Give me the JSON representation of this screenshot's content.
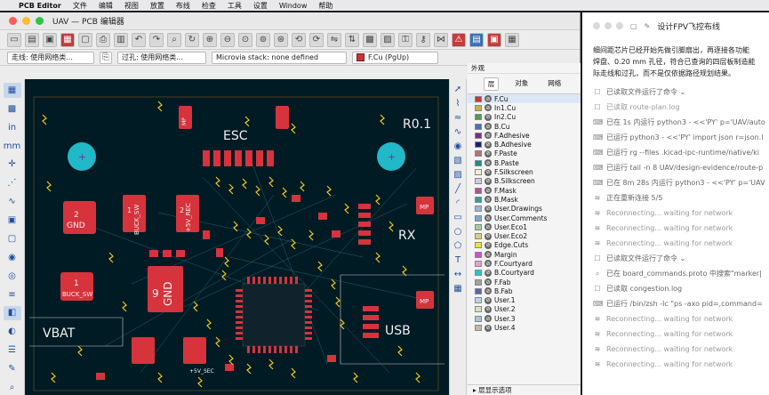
{
  "menubar": {
    "app": "PCB Editor",
    "items": [
      "文件",
      "编辑",
      "视图",
      "放置",
      "布线",
      "检查",
      "工具",
      "设置",
      "Window",
      "帮助"
    ]
  },
  "window": {
    "title": "UAV — PCB 编辑器"
  },
  "subbar": {
    "track": "走线: 使用网络类...",
    "via": "过孔: 使用网络类...",
    "microvia": "Microvia stack: none defined",
    "layer": "F.Cu (PgUp)"
  },
  "board": {
    "labels": {
      "esc": "ESC",
      "rev": "R0.1",
      "rx": "RX",
      "usb": "USB",
      "vbat": "VBAT",
      "gnd": "GND",
      "buck_sw": "BUCK_SW",
      "buck_sw2": "BUCK_SW",
      "v5_rec": "+5V_REC",
      "v5_sec": "+5V_SEC",
      "gnd2": "GND",
      "mp": "MP",
      "n2": "2",
      "n1": "1",
      "n2b": "2",
      "n1b": "1",
      "n9": "9"
    }
  },
  "layers": {
    "header": "外观",
    "tabs": [
      "层",
      "对象",
      "网络"
    ],
    "items": [
      {
        "name": "F.Cu",
        "color": "#c83434"
      },
      {
        "name": "In1.Cu",
        "color": "#c7b24a"
      },
      {
        "name": "In2.Cu",
        "color": "#4fa04a"
      },
      {
        "name": "B.Cu",
        "color": "#4e6fb9"
      },
      {
        "name": "F.Adhesive",
        "color": "#7b2d8a"
      },
      {
        "name": "B.Adhesive",
        "color": "#1d1d7a"
      },
      {
        "name": "F.Paste",
        "color": "#b5707f"
      },
      {
        "name": "B.Paste",
        "color": "#1f8a8a"
      },
      {
        "name": "F.Silkscreen",
        "color": "#f0f0c8"
      },
      {
        "name": "B.Silkscreen",
        "color": "#d4c8e6"
      },
      {
        "name": "F.Mask",
        "color": "#b4528c"
      },
      {
        "name": "B.Mask",
        "color": "#2f9f97"
      },
      {
        "name": "User.Drawings",
        "color": "#9db4d6"
      },
      {
        "name": "User.Comments",
        "color": "#7fa6d2"
      },
      {
        "name": "User.Eco1",
        "color": "#9fcf9f"
      },
      {
        "name": "User.Eco2",
        "color": "#d6d27a"
      },
      {
        "name": "Edge.Cuts",
        "color": "#e6e63a"
      },
      {
        "name": "Margin",
        "color": "#d84ad8"
      },
      {
        "name": "F.Courtyard",
        "color": "#e4a0d6"
      },
      {
        "name": "B.Courtyard",
        "color": "#24c7c7"
      },
      {
        "name": "F.Fab",
        "color": "#a0a0a0"
      },
      {
        "name": "B.Fab",
        "color": "#5566aa"
      },
      {
        "name": "User.1",
        "color": "#b6d6e6"
      },
      {
        "name": "User.2",
        "color": "#d6e6b6"
      },
      {
        "name": "User.3",
        "color": "#a6c6d6"
      },
      {
        "name": "User.4",
        "color": "#c6b6a6"
      }
    ],
    "footer": "层显示选项"
  },
  "chat": {
    "title": "设计FPV飞控布线",
    "para1": "细间距芯片已经开始先做引脚扇出，再逐接各功能",
    "para2": "焊盘、0.20 mm 孔径，符合已查询的四层板制造能",
    "para3": "际走线和过孔，而不是仅依据路径规划结果。",
    "rows": [
      {
        "icon": "file-icon",
        "text": "已读取文件运行了命令 ⌄"
      },
      {
        "icon": "file-icon",
        "text": "已读取 route-plan.log",
        "muted": true
      },
      {
        "icon": "terminal-icon",
        "text": "已在 1s 内运行 python3 - <<'PY' p='UAV/auto"
      },
      {
        "icon": "terminal-icon",
        "text": "已运行 python3 - <<'PY' import json r=json.l"
      },
      {
        "icon": "terminal-icon",
        "text": "已运行 rg --files .kicad-ipc-runtime/native/ki"
      },
      {
        "icon": "terminal-icon",
        "text": "已运行 tail -n 8 UAV/design-evidence/route-p"
      },
      {
        "icon": "terminal-icon",
        "text": "已在 8m 28s 内运行 python3 - <<'PY' p='UAV"
      },
      {
        "icon": "wifi-icon",
        "text": "正在重新连接 5/5"
      },
      {
        "icon": "wifi-icon",
        "text": "Reconnecting... waiting for network",
        "muted": true
      },
      {
        "icon": "wifi-icon",
        "text": "Reconnecting... waiting for network",
        "muted": true
      },
      {
        "icon": "wifi-icon",
        "text": "Reconnecting... waiting for network",
        "muted": true
      },
      {
        "icon": "file-icon",
        "text": "已读取文件运行了命令 ⌄"
      },
      {
        "icon": "search-icon",
        "text": "已在 board_commands.proto 中搜索\"marker|"
      },
      {
        "icon": "file-icon",
        "text": "已读取 congestion.log"
      },
      {
        "icon": "terminal-icon",
        "text": "已运行 /bin/zsh -lc \"ps -axo pid=,command="
      },
      {
        "icon": "wifi-icon",
        "text": "Reconnecting... waiting for network",
        "muted": true
      },
      {
        "icon": "wifi-icon",
        "text": "Reconnecting... waiting for network",
        "muted": true
      },
      {
        "icon": "wifi-icon",
        "text": "Reconnecting... waiting for network",
        "muted": true
      },
      {
        "icon": "wifi-icon",
        "text": "Reconnecting... waiting for network",
        "muted": true
      }
    ]
  }
}
